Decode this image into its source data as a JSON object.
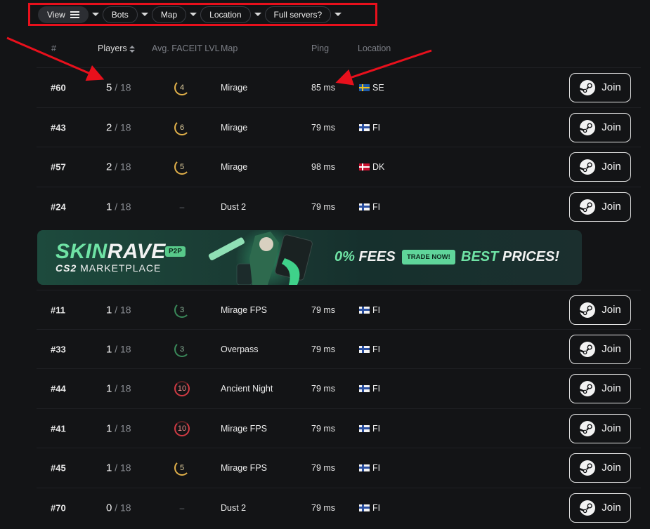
{
  "filters": [
    {
      "label": "View",
      "active": true
    },
    {
      "label": "Bots",
      "active": false
    },
    {
      "label": "Map",
      "active": false
    },
    {
      "label": "Location",
      "active": false
    },
    {
      "label": "Full servers?",
      "active": false
    }
  ],
  "columns": {
    "id": "#",
    "players": "Players",
    "level": "Avg. FACEIT LVL",
    "map": "Map",
    "ping": "Ping",
    "location": "Location"
  },
  "join_label": "Join",
  "rows": [
    {
      "id": "#60",
      "players": "5",
      "max": " / 18",
      "level": "4",
      "level_color": "gold",
      "map": "Mirage",
      "ping": "85 ms",
      "flag": "se",
      "country": "SE"
    },
    {
      "id": "#43",
      "players": "2",
      "max": " / 18",
      "level": "6",
      "level_color": "gold",
      "map": "Mirage",
      "ping": "79 ms",
      "flag": "fi",
      "country": "FI"
    },
    {
      "id": "#57",
      "players": "2",
      "max": " / 18",
      "level": "5",
      "level_color": "gold",
      "map": "Mirage",
      "ping": "98 ms",
      "flag": "dk",
      "country": "DK"
    },
    {
      "id": "#24",
      "players": "1",
      "max": " / 18",
      "level": "–",
      "level_color": "none",
      "map": "Dust 2",
      "ping": "79 ms",
      "flag": "fi",
      "country": "FI"
    },
    {
      "id": "#11",
      "players": "1",
      "max": " / 18",
      "level": "3",
      "level_color": "green",
      "map": "Mirage FPS",
      "ping": "79 ms",
      "flag": "fi",
      "country": "FI"
    },
    {
      "id": "#33",
      "players": "1",
      "max": " / 18",
      "level": "3",
      "level_color": "green",
      "map": "Overpass",
      "ping": "79 ms",
      "flag": "fi",
      "country": "FI"
    },
    {
      "id": "#44",
      "players": "1",
      "max": " / 18",
      "level": "10",
      "level_color": "red",
      "map": "Ancient Night",
      "ping": "79 ms",
      "flag": "fi",
      "country": "FI"
    },
    {
      "id": "#41",
      "players": "1",
      "max": " / 18",
      "level": "10",
      "level_color": "red",
      "map": "Mirage FPS",
      "ping": "79 ms",
      "flag": "fi",
      "country": "FI"
    },
    {
      "id": "#45",
      "players": "1",
      "max": " / 18",
      "level": "5",
      "level_color": "gold",
      "map": "Mirage FPS",
      "ping": "79 ms",
      "flag": "fi",
      "country": "FI"
    },
    {
      "id": "#70",
      "players": "0",
      "max": " / 18",
      "level": "–",
      "level_color": "none",
      "map": "Dust 2",
      "ping": "79 ms",
      "flag": "fi",
      "country": "FI"
    }
  ],
  "banner": {
    "brand_a": "SKIN",
    "brand_b": "RAVE",
    "badge": "P2P",
    "sub_a": "CS2",
    "sub_b": " MARKETPLACE",
    "fees_a": "0%",
    "fees_b": " FEES",
    "cta": "TRADE NOW!",
    "best_a": "BEST",
    "best_b": " PRICES!"
  },
  "annotation_color": "#e8101c"
}
